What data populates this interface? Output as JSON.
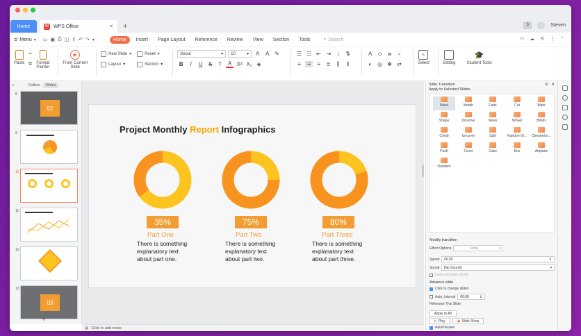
{
  "window": {
    "traffic_colors": [
      "#ff5f57",
      "#febc2e",
      "#28c840"
    ]
  },
  "tabs": {
    "home": "Home",
    "doc": "WPS Office",
    "add": "+"
  },
  "titlebar_right": {
    "badge": "3",
    "user": "Steven"
  },
  "menubar": {
    "menu_label": "Menu",
    "tabs": [
      {
        "label": "Home",
        "active": true
      },
      {
        "label": "Insert"
      },
      {
        "label": "Page Layout"
      },
      {
        "label": "Reference"
      },
      {
        "label": "Review"
      },
      {
        "label": "View"
      },
      {
        "label": "Section"
      },
      {
        "label": "Tools"
      }
    ],
    "search_placeholder": "Search"
  },
  "ribbon": {
    "paste": "Paste",
    "format_painter": [
      "Format",
      "Painter"
    ],
    "from_current": [
      "From Current",
      "Slide"
    ],
    "new_slide": "New Slide",
    "layout": "Layout",
    "reset": "Reset",
    "section": "Section",
    "font_name": "Seoul",
    "font_size": "10",
    "select": "Select",
    "setting": "Setting",
    "student_tools": "Student Tools"
  },
  "left_panel": {
    "tab_outline": "Outline",
    "tab_slides": "Slides",
    "slide_numbers": [
      "8",
      "9",
      "10",
      "11",
      "12",
      "13"
    ],
    "add": "+"
  },
  "slide": {
    "title_pre": "Project Monthly ",
    "title_hl": "Report",
    "title_post": " Infographics",
    "parts": [
      {
        "pct_label": "35%",
        "pct": 35,
        "name": "Part One",
        "text": [
          "There is something",
          "explanatory text",
          "about part one."
        ],
        "ring": "#fdc41f",
        "arc": "#f7931e"
      },
      {
        "pct_label": "75%",
        "pct": 75,
        "name": "Part Two",
        "text": [
          "There is something",
          "explanatory text",
          "about part two."
        ],
        "ring": "#fdc41f",
        "arc": "#f7931e"
      },
      {
        "pct_label": "80%",
        "pct": 80,
        "name": "Part Three",
        "text": [
          "There is something",
          "explanatory text",
          "about part three."
        ],
        "ring": "#fdc41f",
        "arc": "#f7931e"
      }
    ]
  },
  "notes": "Click to add notes",
  "right_panel": {
    "title": "Slide Transition",
    "subtitle": "Apply to Selected Slides",
    "transitions": [
      "None",
      "Morph",
      "Fade",
      "Cut",
      "Wipe",
      "Shape",
      "Dissolve",
      "News",
      "Wheel",
      "Blinds",
      "Comb",
      "Uncover",
      "Split",
      "Random B...",
      "Checkerbo...",
      "Push",
      "Cover",
      "Cube",
      "Box",
      "Airplane",
      "Random"
    ],
    "modify": "Modify transition",
    "effect_options": "Effect Options",
    "effect_value": "None",
    "speed_label": "Speed",
    "speed_value": "00.50",
    "sound_label": "Sound",
    "sound_value": "[No Sound]",
    "loop": "Loop until next sound",
    "advance": "Advance slide",
    "on_click": "Click to change slides",
    "auto_label": "Auto, interval",
    "auto_value": "00:00",
    "rehearse": "Rehearse This Slide",
    "apply_all": "Apply to All",
    "play": "Play",
    "slide_show": "Slide Show",
    "autopreview": "AutoPreview"
  }
}
